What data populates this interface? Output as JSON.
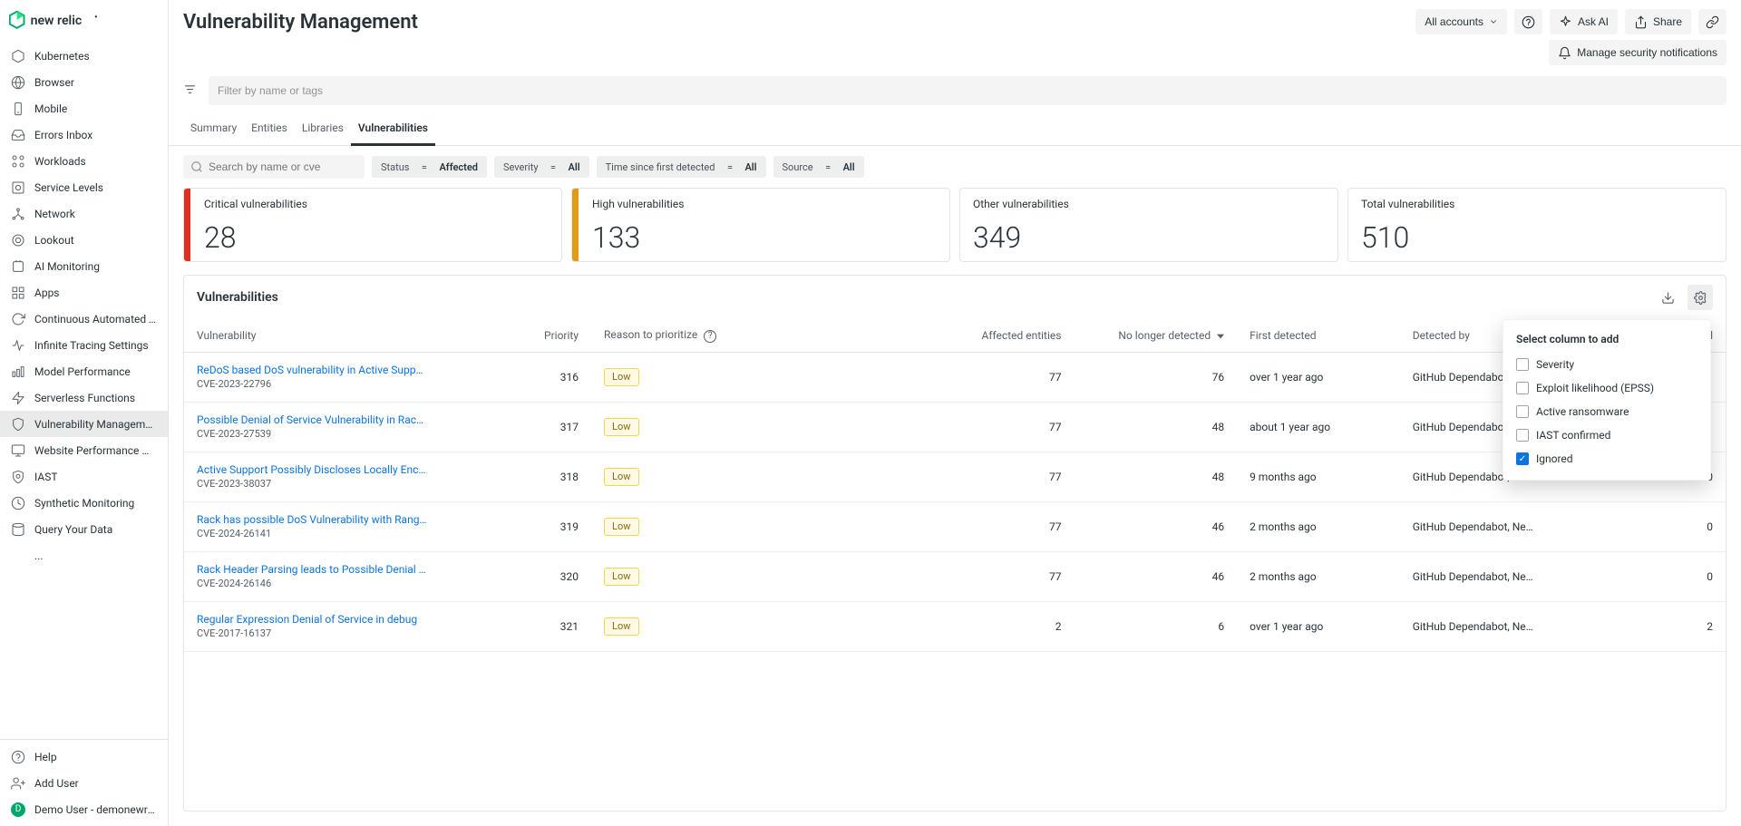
{
  "brand": {
    "name": "new relic"
  },
  "sidebar": {
    "items": [
      {
        "label": "Kubernetes",
        "icon": "kubernetes-icon"
      },
      {
        "label": "Browser",
        "icon": "browser-icon"
      },
      {
        "label": "Mobile",
        "icon": "mobile-icon"
      },
      {
        "label": "Errors Inbox",
        "icon": "errors-inbox-icon"
      },
      {
        "label": "Workloads",
        "icon": "workloads-icon"
      },
      {
        "label": "Service Levels",
        "icon": "service-levels-icon"
      },
      {
        "label": "Network",
        "icon": "network-icon"
      },
      {
        "label": "Lookout",
        "icon": "lookout-icon"
      },
      {
        "label": "AI Monitoring",
        "icon": "ai-monitoring-icon"
      },
      {
        "label": "Apps",
        "icon": "apps-icon"
      },
      {
        "label": "Continuous Automated T…",
        "icon": "continuous-automated-icon"
      },
      {
        "label": "Infinite Tracing Settings",
        "icon": "tracing-icon"
      },
      {
        "label": "Model Performance",
        "icon": "model-performance-icon"
      },
      {
        "label": "Serverless Functions",
        "icon": "serverless-icon"
      },
      {
        "label": "Vulnerability Management",
        "icon": "vulnerability-icon",
        "selected": true
      },
      {
        "label": "Website Performance Mo…",
        "icon": "website-performance-icon"
      },
      {
        "label": "IAST",
        "icon": "iast-icon"
      },
      {
        "label": "Synthetic Monitoring",
        "icon": "synthetic-icon"
      },
      {
        "label": "Query Your Data",
        "icon": "query-icon"
      },
      {
        "label": "...",
        "icon": "more-icon"
      }
    ],
    "footer": {
      "help": "Help",
      "add_user": "Add User",
      "user_name": "Demo User - demonewrel…",
      "user_initial": "D"
    }
  },
  "header": {
    "title": "Vulnerability Management",
    "accounts_btn": "All accounts",
    "ask_ai_btn": "Ask AI",
    "share_btn": "Share",
    "notifications_btn": "Manage security notifications"
  },
  "global_filter": {
    "placeholder": "Filter by name or tags"
  },
  "tabs": [
    {
      "label": "Summary"
    },
    {
      "label": "Entities"
    },
    {
      "label": "Libraries"
    },
    {
      "label": "Vulnerabilities",
      "active": true
    }
  ],
  "filters": {
    "search_placeholder": "Search by name or cve",
    "pills": [
      {
        "key": "Status",
        "op": "=",
        "value": "Affected"
      },
      {
        "key": "Severity",
        "op": "=",
        "value": "All"
      },
      {
        "key": "Time since first detected",
        "op": "=",
        "value": "All"
      },
      {
        "key": "Source",
        "op": "=",
        "value": "All"
      }
    ]
  },
  "summary": [
    {
      "label": "Critical vulnerabilities",
      "value": "28",
      "accent": "critical"
    },
    {
      "label": "High vulnerabilities",
      "value": "133",
      "accent": "high"
    },
    {
      "label": "Other vulnerabilities",
      "value": "349"
    },
    {
      "label": "Total vulnerabilities",
      "value": "510"
    }
  ],
  "table": {
    "title": "Vulnerabilities",
    "columns": {
      "vulnerability": "Vulnerability",
      "priority": "Priority",
      "reason": "Reason to prioritize",
      "entities": "Affected entities",
      "no_longer_detected": "No longer detected",
      "first_detected": "First detected",
      "source": "Detected by",
      "ignored": "Ignored"
    },
    "rows": [
      {
        "title": "ReDoS based DoS vulnerability in Active Supp…",
        "cve": "CVE-2023-22796",
        "priority": "316",
        "severity": "Low",
        "entities": "77",
        "nld": "76",
        "first": "over 1 year ago",
        "source": "GitHub Dependabot, Ne…",
        "ignored": ""
      },
      {
        "title": "Possible Denial of Service Vulnerability in Rac…",
        "cve": "CVE-2023-27539",
        "priority": "317",
        "severity": "Low",
        "entities": "77",
        "nld": "48",
        "first": "about 1 year ago",
        "source": "GitHub Dependabot, Ne…",
        "ignored": ""
      },
      {
        "title": "Active Support Possibly Discloses Locally Enc…",
        "cve": "CVE-2023-38037",
        "priority": "318",
        "severity": "Low",
        "entities": "77",
        "nld": "48",
        "first": "9 months ago",
        "source": "GitHub Dependabot, Ne…",
        "ignored": "0"
      },
      {
        "title": "Rack has possible DoS Vulnerability with Rang…",
        "cve": "CVE-2024-26141",
        "priority": "319",
        "severity": "Low",
        "entities": "77",
        "nld": "46",
        "first": "2 months ago",
        "source": "GitHub Dependabot, Ne…",
        "ignored": "0"
      },
      {
        "title": "Rack Header Parsing leads to Possible Denial …",
        "cve": "CVE-2024-26146",
        "priority": "320",
        "severity": "Low",
        "entities": "77",
        "nld": "46",
        "first": "2 months ago",
        "source": "GitHub Dependabot, Ne…",
        "ignored": "0"
      },
      {
        "title": "Regular Expression Denial of Service in debug",
        "cve": "CVE-2017-16137",
        "priority": "321",
        "severity": "Low",
        "entities": "2",
        "nld": "6",
        "first": "over 1 year ago",
        "source": "GitHub Dependabot, Ne…",
        "ignored": "2"
      }
    ]
  },
  "column_popup": {
    "title": "Select column to add",
    "options": [
      {
        "label": "Severity",
        "checked": false
      },
      {
        "label": "Exploit likelihood (EPSS)",
        "checked": false
      },
      {
        "label": "Active ransomware",
        "checked": false
      },
      {
        "label": "IAST confirmed",
        "checked": false
      },
      {
        "label": "Ignored",
        "checked": true
      }
    ]
  }
}
